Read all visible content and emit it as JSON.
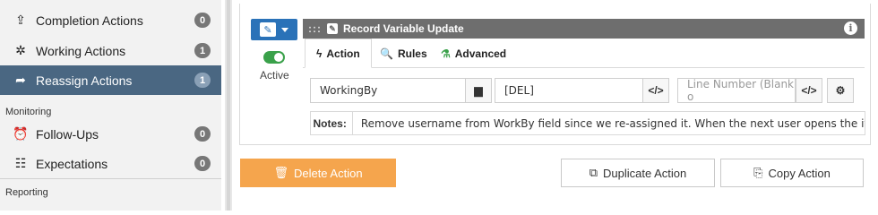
{
  "sidebar": {
    "items": [
      {
        "label": "Completion Actions",
        "count": "0",
        "icon": "clipboard-upload-icon",
        "glyph": "⇪"
      },
      {
        "label": "Working Actions",
        "count": "1",
        "icon": "tools-icon",
        "glyph": "✲"
      },
      {
        "label": "Reassign Actions",
        "count": "1",
        "icon": "share-arrow-icon",
        "glyph": "➦"
      },
      {
        "label": "Follow-Ups",
        "count": "0",
        "icon": "alarm-clock-icon",
        "glyph": "⏰"
      },
      {
        "label": "Expectations",
        "count": "0",
        "icon": "checklist-icon",
        "glyph": "☷"
      }
    ],
    "sections": {
      "monitoring": "Monitoring",
      "reporting": "Reporting"
    }
  },
  "action": {
    "active_label": "Active",
    "header_title": "Record Variable Update",
    "header_grip": ":::",
    "tabs": [
      {
        "label": "Action",
        "glyph": "ϟ"
      },
      {
        "label": "Rules",
        "glyph": "🔍"
      },
      {
        "label": "Advanced",
        "glyph": "⚗"
      }
    ],
    "fields": {
      "variable": "WorkingBy",
      "value": "[DEL]",
      "line_number_placeholder": "Line Number (Blank o",
      "code_glyph": "</>",
      "gear_glyph": "⚙",
      "folder_glyph": "▆"
    },
    "notes_label": "Notes:",
    "notes_text": "Remove username from WorkBy field since we re-assigned it. When the next user opens the item it will"
  },
  "buttons": {
    "delete": "Delete Action",
    "duplicate": "Duplicate Action",
    "copy": "Copy Action",
    "delete_glyph": "🗑",
    "duplicate_glyph": "⧉",
    "copy_glyph": "⎘"
  },
  "colors": {
    "accent_blue": "#2a72b8",
    "active_sidebar": "#4a6782",
    "delete_orange": "#f5a54d",
    "toggle_green": "#3aa14a",
    "header_gray": "#6e6e6e"
  }
}
